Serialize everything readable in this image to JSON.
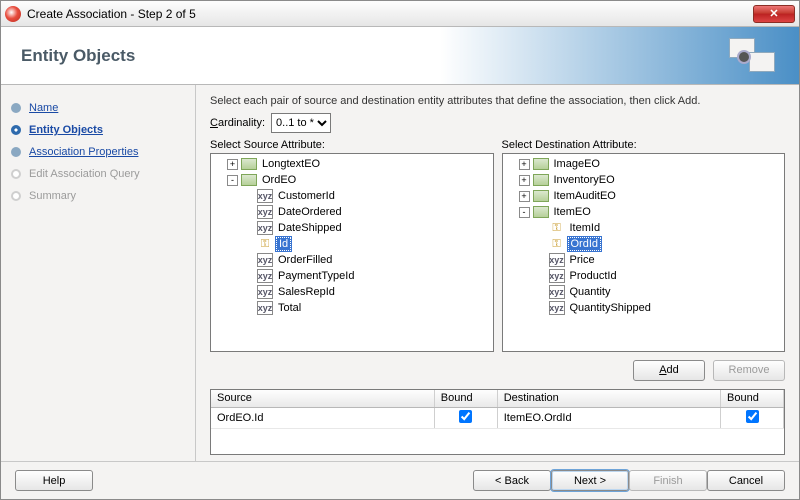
{
  "window": {
    "title": "Create Association - Step 2 of 5"
  },
  "banner": {
    "title": "Entity Objects"
  },
  "steps": {
    "items": [
      {
        "label": "Name",
        "state": "past"
      },
      {
        "label": "Entity Objects",
        "state": "current"
      },
      {
        "label": "Association Properties",
        "state": "past"
      },
      {
        "label": "Edit Association Query",
        "state": "future"
      },
      {
        "label": "Summary",
        "state": "future"
      }
    ]
  },
  "content": {
    "instruction": "Select each pair of source and destination entity attributes that define the association, then click Add.",
    "cardinality_label": "Cardinality:",
    "cardinality_value": "0..1 to *",
    "source_label": "Select Source Attribute:",
    "dest_label": "Select Destination Attribute:",
    "add_label": "Add",
    "remove_label": "Remove"
  },
  "source_tree": {
    "nodes": [
      {
        "depth": 1,
        "exp": "+",
        "icon": "ent",
        "label": "LongtextEO"
      },
      {
        "depth": 1,
        "exp": "-",
        "icon": "ent",
        "label": "OrdEO"
      },
      {
        "depth": 2,
        "exp": "",
        "icon": "attr",
        "label": "CustomerId"
      },
      {
        "depth": 2,
        "exp": "",
        "icon": "attr",
        "label": "DateOrdered"
      },
      {
        "depth": 2,
        "exp": "",
        "icon": "attr",
        "label": "DateShipped"
      },
      {
        "depth": 2,
        "exp": "",
        "icon": "key",
        "label": "Id",
        "selected": true
      },
      {
        "depth": 2,
        "exp": "",
        "icon": "attr",
        "label": "OrderFilled"
      },
      {
        "depth": 2,
        "exp": "",
        "icon": "attr",
        "label": "PaymentTypeId"
      },
      {
        "depth": 2,
        "exp": "",
        "icon": "attr",
        "label": "SalesRepId"
      },
      {
        "depth": 2,
        "exp": "",
        "icon": "attr",
        "label": "Total"
      }
    ]
  },
  "dest_tree": {
    "nodes": [
      {
        "depth": 1,
        "exp": "+",
        "icon": "ent",
        "label": "ImageEO"
      },
      {
        "depth": 1,
        "exp": "+",
        "icon": "ent",
        "label": "InventoryEO"
      },
      {
        "depth": 1,
        "exp": "+",
        "icon": "ent",
        "label": "ItemAuditEO"
      },
      {
        "depth": 1,
        "exp": "-",
        "icon": "ent",
        "label": "ItemEO"
      },
      {
        "depth": 2,
        "exp": "",
        "icon": "key",
        "label": "ItemId"
      },
      {
        "depth": 2,
        "exp": "",
        "icon": "key",
        "label": "OrdId",
        "selected": true
      },
      {
        "depth": 2,
        "exp": "",
        "icon": "attr",
        "label": "Price"
      },
      {
        "depth": 2,
        "exp": "",
        "icon": "attr",
        "label": "ProductId"
      },
      {
        "depth": 2,
        "exp": "",
        "icon": "attr",
        "label": "Quantity"
      },
      {
        "depth": 2,
        "exp": "",
        "icon": "attr",
        "label": "QuantityShipped"
      }
    ]
  },
  "grid": {
    "headers": {
      "source": "Source",
      "src_bound": "Bound",
      "dest": "Destination",
      "dst_bound": "Bound"
    },
    "rows": [
      {
        "source": "OrdEO.Id",
        "src_bound": true,
        "dest": "ItemEO.OrdId",
        "dst_bound": true
      }
    ]
  },
  "footer": {
    "help": "Help",
    "back": "< Back",
    "next": "Next >",
    "finish": "Finish",
    "cancel": "Cancel"
  }
}
